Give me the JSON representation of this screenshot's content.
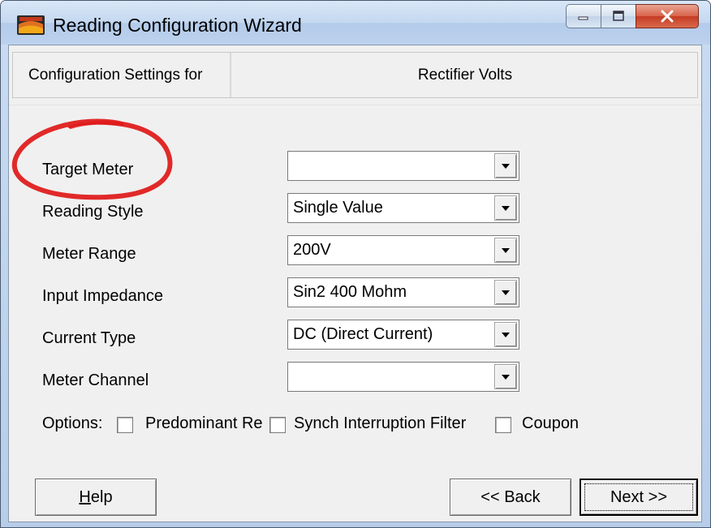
{
  "window": {
    "title": "Reading Configuration Wizard",
    "icon": "app-logo-icon"
  },
  "header": {
    "left_label": "Configuration Settings for",
    "right_label": "Rectifier Volts"
  },
  "fields": [
    {
      "label": "Target Meter",
      "value": ""
    },
    {
      "label": "Reading Style",
      "value": "Single Value"
    },
    {
      "label": "Meter Range",
      "value": "200V"
    },
    {
      "label": "Input Impedance",
      "value": "Sin2 400 Mohm"
    },
    {
      "label": "Current Type",
      "value": "DC (Direct Current)"
    },
    {
      "label": "Meter Channel",
      "value": ""
    }
  ],
  "options": {
    "label": "Options:",
    "items": [
      {
        "label": "Predominant Re",
        "checked": false
      },
      {
        "label": "Synch Interruption Filter",
        "checked": false
      },
      {
        "label": "Coupon",
        "checked": false
      }
    ]
  },
  "buttons": {
    "help_accel": "H",
    "help_rest": "elp",
    "back": "<< Back",
    "next": "Next >>"
  },
  "annotation_color": "#e01818"
}
